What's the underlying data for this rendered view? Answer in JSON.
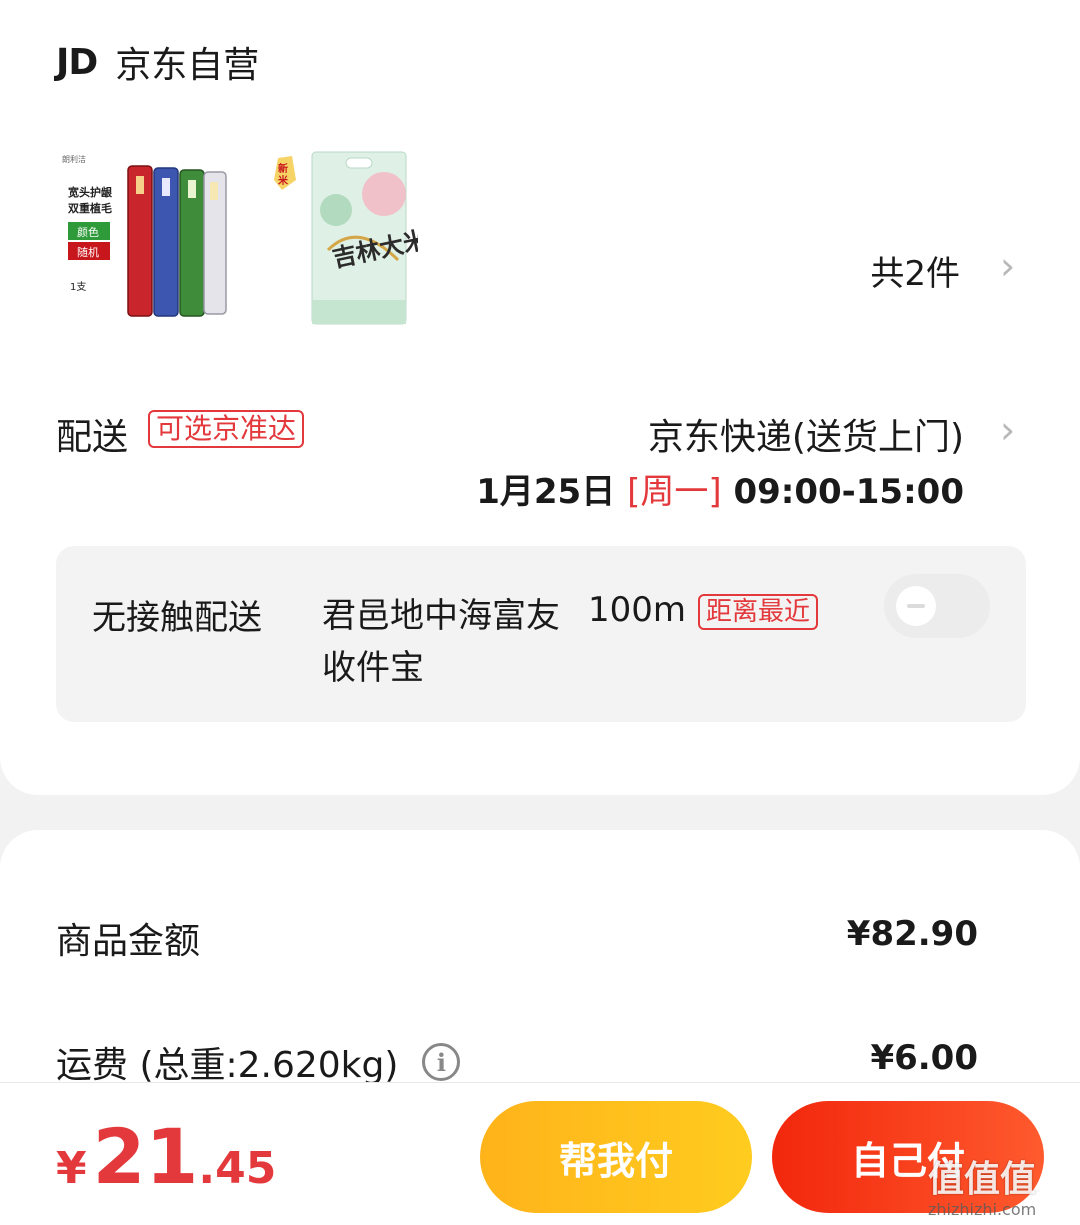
{
  "shop": {
    "logo": "JD",
    "name": "京东自营"
  },
  "products": {
    "count_text": "共2件",
    "toothbrush": {
      "brand": "朗利洁",
      "line1": "宽头护龈",
      "line2": "双重植毛",
      "color_tag": "颜色",
      "random_tag": "随机",
      "qty": "1支"
    },
    "rice": {
      "badge_top": "新",
      "badge_bottom": "米",
      "name": "吉林大米"
    }
  },
  "delivery": {
    "label": "配送",
    "tag": "可选京准达",
    "carrier": "京东快递(送货上门)",
    "date": "1月25日",
    "weekday": "[周一]",
    "time": "09:00-15:00"
  },
  "contactless": {
    "label": "无接触配送",
    "address": "君邑地中海富友收件宝",
    "distance": "100m",
    "tag": "距离最近"
  },
  "summary": {
    "goods_label": "商品金额",
    "goods_value": "¥82.90",
    "shipping_label": "运费 (总重:2.620kg)",
    "shipping_value": "¥6.00"
  },
  "footer": {
    "currency": "¥",
    "total_int": "21",
    "total_dec": ".45",
    "help_pay": "帮我付",
    "self_pay": "自己付"
  },
  "watermark": {
    "logo": "值值值",
    "site": "zhizhizhi.com"
  },
  "colors": {
    "accent_red": "#e3393c",
    "help_yellow": "#ffb31a",
    "pay_red": "#f2270c"
  }
}
